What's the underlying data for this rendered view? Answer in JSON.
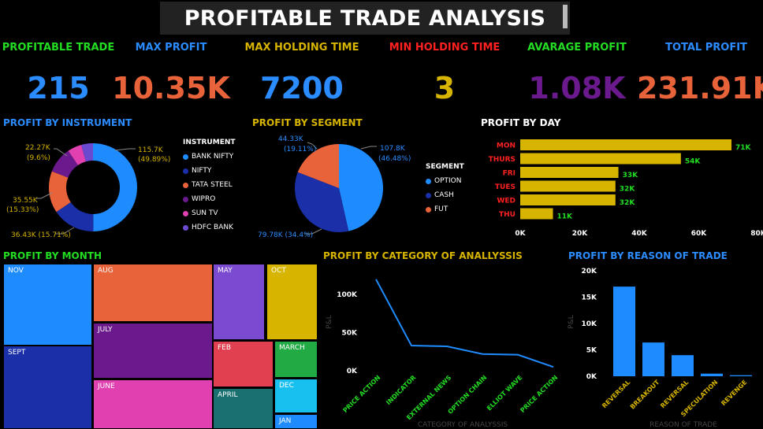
{
  "title": "PROFITABLE TRADE ANALYSIS",
  "kpis": [
    {
      "label": "PROFITABLE TRADE",
      "value": "215",
      "label_color": "#22dd22",
      "value_color": "#2a8cff"
    },
    {
      "label": "MAX PROFIT",
      "value": "10.35K",
      "label_color": "#2a8cff",
      "value_color": "#e8623a"
    },
    {
      "label": "MAX HOLDING TIME",
      "value": "7200",
      "label_color": "#d6b400",
      "value_color": "#2a8cff"
    },
    {
      "label": "MIN HOLDING TIME",
      "value": "3",
      "label_color": "#ff2020",
      "value_color": "#d6b400"
    },
    {
      "label": "AVARAGE PROFIT",
      "value": "1.08K",
      "label_color": "#22dd22",
      "value_color": "#6a1a8c"
    },
    {
      "label": "TOTAL PROFIT",
      "value": "231.91K",
      "label_color": "#2a8cff",
      "value_color": "#e8623a"
    }
  ],
  "instrument": {
    "title": "PROFIT BY INSTRUMENT",
    "legend_title": "INSTRUMENT",
    "labels": {
      "bank_nifty": "115.7K",
      "bank_nifty_pct": "(49.89%)",
      "nifty": "36.43K (15.71%)",
      "tata_steel": "35.55K",
      "tata_steel_pct": "(15.33%)",
      "wipro": "22.27K",
      "wipro_pct": "(9.6%)"
    }
  },
  "segment": {
    "title": "PROFIT BY SEGMENT",
    "legend_title": "SEGMENT",
    "labels": {
      "option": "107.8K",
      "option_pct": "(46.48%)",
      "cash": "79.78K (34.4%)",
      "fut": "44.33K",
      "fut_pct": "(19.11%)"
    }
  },
  "day": {
    "title": "PROFIT BY DAY"
  },
  "month": {
    "title": "PROFIT BY MONTH"
  },
  "category": {
    "title": "PROFIT BY CATEGORY OF ANALLYSSIS"
  },
  "reason": {
    "title": "PROFIT BY REASON OF TRADE"
  },
  "colors": {
    "green": "#22dd22",
    "blue": "#2a8cff",
    "gold": "#d6b400",
    "red": "#ff2020",
    "orange": "#e8623a"
  },
  "chart_data": [
    {
      "type": "pie",
      "title": "PROFIT BY INSTRUMENT",
      "legend_title": "INSTRUMENT",
      "categories": [
        "BANK NIFTY",
        "NIFTY",
        "TATA STEEL",
        "WIPRO",
        "SUN TV",
        "HDFC BANK"
      ],
      "values": [
        115.7,
        36.43,
        35.55,
        22.27,
        12.0,
        9.96
      ],
      "colors": [
        "#1e8cff",
        "#1a2fa8",
        "#e8623a",
        "#6a1a8c",
        "#e040b0",
        "#6a4ad0"
      ]
    },
    {
      "type": "pie",
      "title": "PROFIT BY SEGMENT",
      "legend_title": "SEGMENT",
      "categories": [
        "OPTION",
        "CASH",
        "FUT"
      ],
      "values": [
        107.8,
        79.78,
        44.33
      ],
      "colors": [
        "#1e8cff",
        "#1a2fa8",
        "#e8623a"
      ]
    },
    {
      "type": "bar",
      "title": "PROFIT BY DAY",
      "categories": [
        "MON",
        "THURS",
        "FRI",
        "TUES",
        "WED",
        "THU"
      ],
      "values": [
        71,
        54,
        33,
        32,
        32,
        11
      ],
      "value_labels": [
        "71K",
        "54K",
        "33K",
        "32K",
        "32K",
        "11K"
      ],
      "xticks": [
        "0K",
        "20K",
        "40K",
        "60K",
        "80K"
      ],
      "xlim": [
        0,
        80
      ]
    },
    {
      "type": "heatmap",
      "title": "PROFIT BY MONTH",
      "categories": [
        "NOV",
        "SEPT",
        "AUG",
        "JULY",
        "JUNE",
        "MAY",
        "OCT",
        "FEB",
        "MARCH",
        "APRIL",
        "DEC",
        "JAN"
      ],
      "colors": [
        "#1e8cff",
        "#1a2fa8",
        "#e8623a",
        "#6a1a8c",
        "#e040b0",
        "#7a4ad0",
        "#d6b400",
        "#e04050",
        "#22aa44",
        "#1a7070",
        "#18c0f0",
        "#1e8cff"
      ]
    },
    {
      "type": "line",
      "title": "PROFIT BY CATEGORY OF ANALLYSSIS",
      "xlabel": "CATEGORY OF ANALYSSIS",
      "ylabel": "P&L",
      "categories": [
        "PRICE ACTION",
        "INDICATOR",
        "EXTERNAL NEWS",
        "OPTION CHAIN",
        "ELLIOT WAVE",
        "PRICE ACTION"
      ],
      "values": [
        120,
        33,
        32,
        22,
        21,
        5
      ],
      "yticks": [
        "0K",
        "50K",
        "100K"
      ],
      "ylim": [
        0,
        125
      ]
    },
    {
      "type": "bar",
      "title": "PROFIT BY REASON OF TRADE",
      "xlabel": "REASON OF TRADE",
      "ylabel": "P&L",
      "categories": [
        "REVERSAL",
        "BREAKOUT",
        "REVERSAL",
        "SPECULATION",
        "REVENGE"
      ],
      "values": [
        17,
        6.4,
        4,
        0.5,
        0.2
      ],
      "yticks": [
        "0K",
        "5K",
        "10K",
        "15K",
        "20K"
      ],
      "ylim": [
        0,
        20
      ]
    }
  ]
}
